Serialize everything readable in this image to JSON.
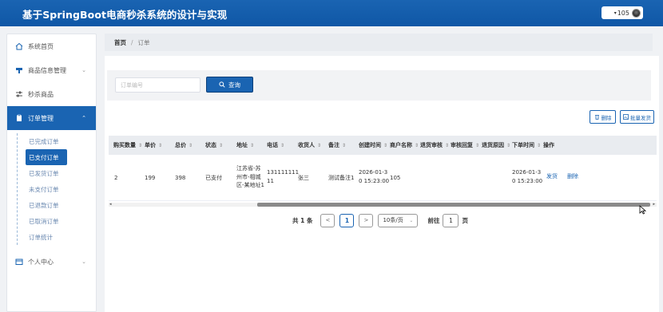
{
  "app": {
    "title": "基于SpringBoot电商秒杀系统的设计与实现"
  },
  "user": {
    "caret": "▾",
    "name": "105"
  },
  "sidebar": {
    "items": [
      {
        "label": "系统首页",
        "icon": "home-icon"
      },
      {
        "label": "商品信息管理",
        "icon": "goods-icon",
        "arrow": "⌄"
      },
      {
        "label": "秒杀商品",
        "icon": "sliders-icon"
      },
      {
        "label": "订单管理",
        "icon": "clipboard-icon",
        "arrow": "⌃"
      },
      {
        "label": "个人中心",
        "icon": "user-card-icon",
        "arrow": "⌄"
      }
    ],
    "sub_items": [
      {
        "label": "已完成订单"
      },
      {
        "label": "已支付订单"
      },
      {
        "label": "已发货订单"
      },
      {
        "label": "未支付订单"
      },
      {
        "label": "已退款订单"
      },
      {
        "label": "已取消订单"
      },
      {
        "label": "订单统计"
      }
    ]
  },
  "breadcrumb": {
    "home": "首页",
    "sep": "/",
    "current": "订单"
  },
  "search": {
    "placeholder": "订单编号",
    "button_label": "查询"
  },
  "toolbar": {
    "delete_label": "删除",
    "batch_ship_label": "批量发货"
  },
  "table": {
    "columns": [
      "购买数量",
      "单价",
      "总价",
      "状态",
      "地址",
      "电话",
      "收货人",
      "备注",
      "创建时间",
      "商户名称",
      "退货审核",
      "审核回复",
      "退货原因",
      "下单时间",
      "操作"
    ],
    "sort_mark": "⇕",
    "rows": [
      {
        "qty": "2",
        "price": "199",
        "total": "398",
        "status": "已支付",
        "address": [
          "江苏省-苏",
          "州市-相城",
          "区-某地址1"
        ],
        "phone": [
          "131111111",
          "11"
        ],
        "receiver": "张三",
        "remark": "测试备注1",
        "created": [
          "2026-01-3",
          "0 15:23:00"
        ],
        "merchant": "105",
        "order_time": [
          "2026-01-3",
          "0 15:23:00"
        ],
        "ship_label": "发货",
        "delete_label": "删除"
      }
    ]
  },
  "pager": {
    "total": "共 1 条",
    "prev": "<",
    "page": "1",
    "next": ">",
    "page_size": "10条/页",
    "goto_label": "前往",
    "goto_value": "1",
    "page_suffix": "页"
  },
  "colors": {
    "accent": "#1a64b2",
    "header": "#0f57a6"
  }
}
